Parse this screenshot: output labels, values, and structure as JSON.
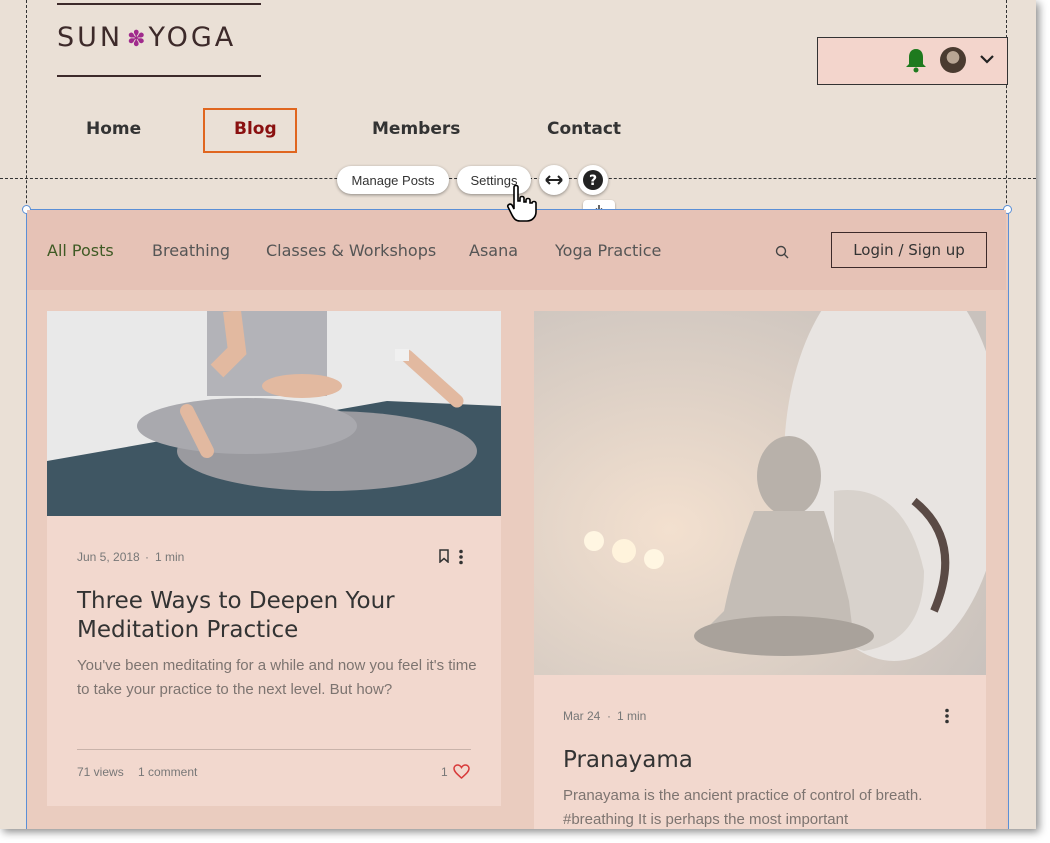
{
  "logo": {
    "part1": "SUN",
    "flower": "✽",
    "part2": "YOGA"
  },
  "nav": {
    "home": "Home",
    "blog": "Blog",
    "members": "Members",
    "contact": "Contact"
  },
  "editor_toolbar": {
    "manage_posts": "Manage Posts",
    "settings": "Settings",
    "stretch_icon": "double-arrow-icon",
    "help_icon": "help-icon",
    "download_icon": "download-icon"
  },
  "header_user": {
    "bell_icon": "bell-icon",
    "avatar": "user-avatar",
    "chevron": "chevron-down-icon"
  },
  "blog": {
    "categories": [
      "All Posts",
      "Breathing",
      "Classes & Workshops",
      "Asana",
      "Yoga Practice"
    ],
    "search_icon": "search-icon",
    "login_label": "Login / Sign up"
  },
  "posts": [
    {
      "date": "Jun 5, 2018",
      "sep": "·",
      "read_time": "1 min",
      "title": "Three Ways to Deepen Your Meditation Practice",
      "excerpt": "You've been meditating for a while and now you feel it's time to take your practice to the next level. But how?",
      "views": "71 views",
      "comments": "1 comment",
      "likes": "1",
      "image": "person-meditating-on-mat"
    },
    {
      "date": "Mar 24",
      "sep": "·",
      "read_time": "1 min",
      "title": "Pranayama",
      "excerpt": "Pranayama is the ancient practice of control of breath. #breathing It is perhaps the most important",
      "image": "buddha-statue-with-candles"
    }
  ],
  "colors": {
    "canvas": "#eae0d6",
    "accent_orange": "#e0661f",
    "active_category": "#3f5a24",
    "bell": "#1e7a1e",
    "heart": "#d83a3a",
    "selection": "#5b8fd6"
  }
}
